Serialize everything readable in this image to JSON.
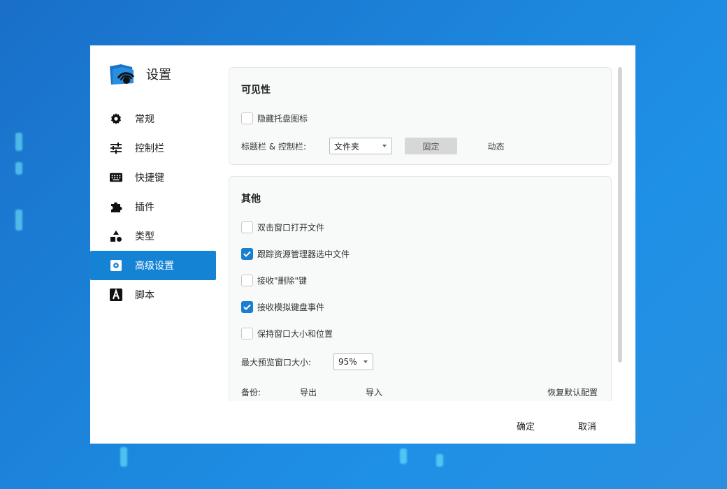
{
  "app": {
    "title": "设置"
  },
  "sidebar": {
    "items": [
      {
        "label": "常规",
        "icon": "gear-icon"
      },
      {
        "label": "控制栏",
        "icon": "sliders-icon"
      },
      {
        "label": "快捷键",
        "icon": "keyboard-icon"
      },
      {
        "label": "插件",
        "icon": "puzzle-icon"
      },
      {
        "label": "类型",
        "icon": "shapes-icon"
      },
      {
        "label": "高级设置",
        "icon": "gear-box-icon",
        "active": true
      },
      {
        "label": "脚本",
        "icon": "script-a-icon"
      }
    ]
  },
  "visibility": {
    "title": "可见性",
    "hide_tray_icon": {
      "label": "隐藏托盘图标",
      "checked": false
    },
    "titlebar_label": "标题栏 & 控制栏:",
    "titlebar_select": "文件夹",
    "fixed_label": "固定",
    "dynamic_label": "动态"
  },
  "other": {
    "title": "其他",
    "options": [
      {
        "label": "双击窗口打开文件",
        "checked": false
      },
      {
        "label": "跟踪资源管理器选中文件",
        "checked": true
      },
      {
        "label": "接收\"删除\"键",
        "checked": false
      },
      {
        "label": "接收模拟键盘事件",
        "checked": true
      },
      {
        "label": "保持窗口大小和位置",
        "checked": false
      }
    ],
    "max_preview_label": "最大预览窗口大小:",
    "max_preview_value": "95%",
    "backup_label": "备份:",
    "export_label": "导出",
    "import_label": "导入",
    "restore_label": "恢复默认配置"
  },
  "footer": {
    "ok_label": "确定",
    "cancel_label": "取消"
  },
  "colors": {
    "accent": "#1483d4",
    "check": "#1a7fd0"
  }
}
